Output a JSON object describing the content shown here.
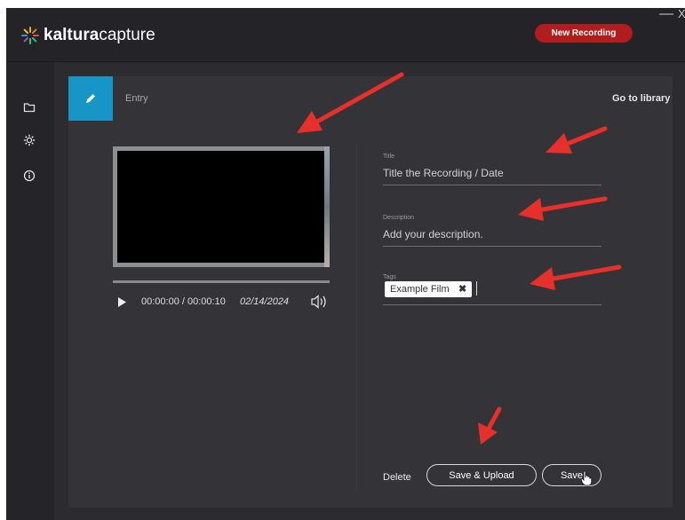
{
  "app": {
    "logo_bold": "kaltura",
    "logo_light": "capture",
    "new_recording": "New Recording",
    "minimize": "—",
    "close": "X"
  },
  "sidebar": {
    "items": [
      {
        "icon": "folder-icon"
      },
      {
        "icon": "gear-icon"
      },
      {
        "icon": "info-icon"
      }
    ]
  },
  "panel": {
    "tab_label": "Entry",
    "go_to_library": "Go to library"
  },
  "player": {
    "time": "00:00:00 / 00:00:10",
    "date": "02/14/2024"
  },
  "form": {
    "title_label": "Title",
    "title_value": "Title the Recording / Date",
    "description_label": "Description",
    "description_value": "Add your description.",
    "tags_label": "Tags",
    "tags": [
      "Example Film"
    ],
    "tag_remove": "✖"
  },
  "actions": {
    "delete": "Delete",
    "save_upload": "Save & Upload",
    "save": "Save"
  },
  "colors": {
    "accent": "#1895c7",
    "record": "#b11c1c",
    "annotation_arrow": "#e8302a"
  }
}
